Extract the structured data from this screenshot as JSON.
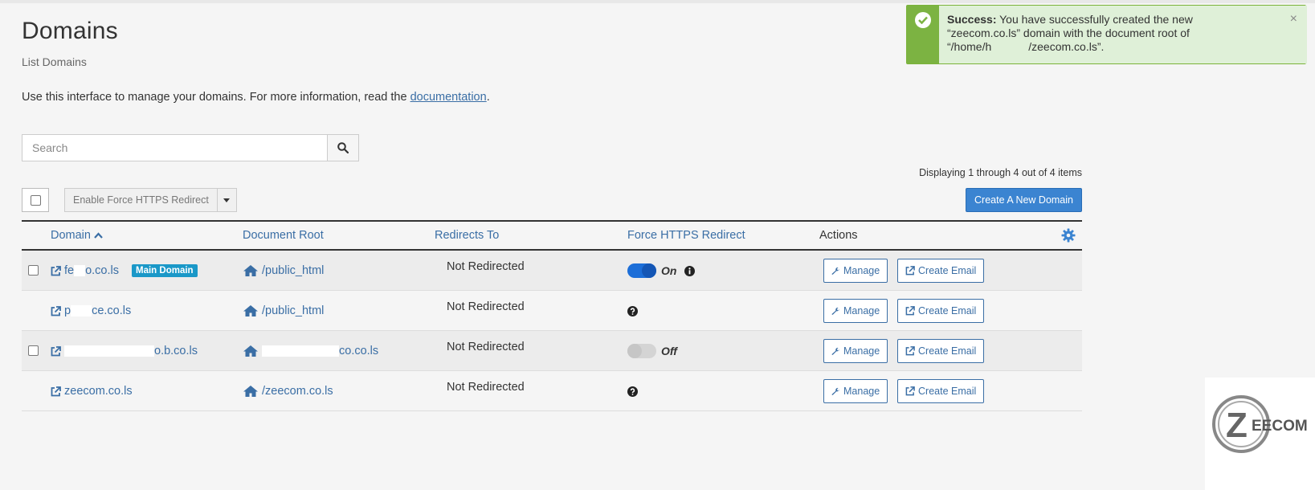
{
  "page": {
    "title": "Domains",
    "subtitle": "List Domains",
    "intro_text": "Use this interface to manage your domains. For more information, read the ",
    "intro_link": "documentation",
    "intro_end": "."
  },
  "search": {
    "placeholder": "Search"
  },
  "toolbar": {
    "displaying": "Displaying 1 through 4 out of 4 items",
    "bulk_action": "Enable Force HTTPS Redirect",
    "create_domain": "Create A New Domain"
  },
  "table": {
    "headers": {
      "domain": "Domain",
      "document_root": "Document Root",
      "redirects_to": "Redirects To",
      "force_https": "Force HTTPS Redirect",
      "actions": "Actions"
    },
    "rows": [
      {
        "domain_start": "fe",
        "domain_end": "o.co.ls",
        "badge": "Main Domain",
        "document_root": "/public_html",
        "redirects": "Not Redirected",
        "force_https": "On",
        "manage": "Manage",
        "create_email": "Create Email"
      },
      {
        "domain_start": "p",
        "domain_end": "ce.co.ls",
        "document_root": "/public_html",
        "redirects": "Not Redirected",
        "manage": "Manage",
        "create_email": "Create Email"
      },
      {
        "domain_start": "",
        "domain_end": "o.b.co.ls",
        "document_root_start": "",
        "document_root_end": "co.co.ls",
        "redirects": "Not Redirected",
        "force_https": "Off",
        "manage": "Manage",
        "create_email": "Create Email"
      },
      {
        "domain_start": "zeecom.co.ls",
        "domain_end": "",
        "document_root": "/zeecom.co.ls",
        "redirects": "Not Redirected",
        "manage": "Manage",
        "create_email": "Create Email"
      }
    ]
  },
  "toast": {
    "heading": "Success:",
    "line1": " You have successfully created the new",
    "line2": "“zeecom.co.ls” domain with the document root of",
    "line3_start": "“/home/h",
    "line3_end": "/zeecom.co.ls”.",
    "close": "×"
  },
  "logo": {
    "text": "EECOM",
    "letter": "Z"
  },
  "colors": {
    "link": "#3a6ea5",
    "primary": "#3b84d1",
    "badge": "#1a98c8",
    "toggle_on": "#1c6ed8",
    "success": "#8bc34a"
  }
}
